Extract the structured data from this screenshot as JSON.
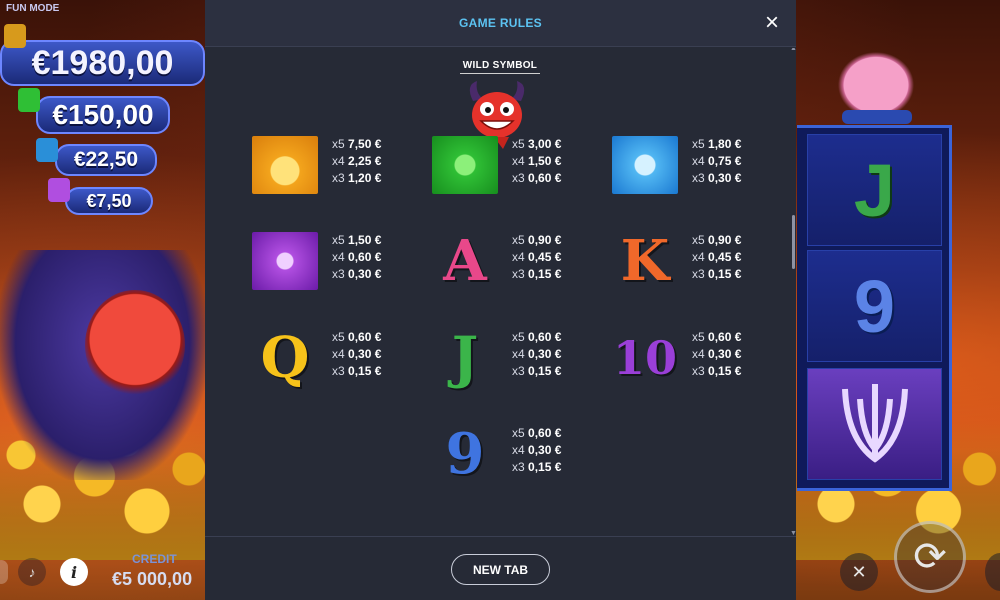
{
  "background": {
    "fun_mode_label": "FUN MODE",
    "jackpots": [
      "€1980,00",
      "€150,00",
      "€22,50",
      "€7,50"
    ],
    "credit_label": "CREDIT",
    "credit_value": "€5 000,00",
    "reel_symbols": [
      "J",
      "9",
      "trident"
    ]
  },
  "modal": {
    "title": "GAME RULES",
    "close_icon": "×",
    "wild_title": "WILD SYMBOL",
    "paytable": [
      {
        "symbol": "crown",
        "lines": [
          {
            "mult": "x5",
            "amt": "7,50 €"
          },
          {
            "mult": "x4",
            "amt": "2,25 €"
          },
          {
            "mult": "x3",
            "amt": "1,20 €"
          }
        ]
      },
      {
        "symbol": "money",
        "lines": [
          {
            "mult": "x5",
            "amt": "3,00 €"
          },
          {
            "mult": "x4",
            "amt": "1,50 €"
          },
          {
            "mult": "x3",
            "amt": "0,60 €"
          }
        ]
      },
      {
        "symbol": "diamond",
        "lines": [
          {
            "mult": "x5",
            "amt": "1,80 €"
          },
          {
            "mult": "x4",
            "amt": "0,75 €"
          },
          {
            "mult": "x3",
            "amt": "0,30 €"
          }
        ]
      },
      {
        "symbol": "trident",
        "lines": [
          {
            "mult": "x5",
            "amt": "1,50 €"
          },
          {
            "mult": "x4",
            "amt": "0,60 €"
          },
          {
            "mult": "x3",
            "amt": "0,30 €"
          }
        ]
      },
      {
        "symbol": "A",
        "lines": [
          {
            "mult": "x5",
            "amt": "0,90 €"
          },
          {
            "mult": "x4",
            "amt": "0,45 €"
          },
          {
            "mult": "x3",
            "amt": "0,15 €"
          }
        ]
      },
      {
        "symbol": "K",
        "lines": [
          {
            "mult": "x5",
            "amt": "0,90 €"
          },
          {
            "mult": "x4",
            "amt": "0,45 €"
          },
          {
            "mult": "x3",
            "amt": "0,15 €"
          }
        ]
      },
      {
        "symbol": "Q",
        "lines": [
          {
            "mult": "x5",
            "amt": "0,60 €"
          },
          {
            "mult": "x4",
            "amt": "0,30 €"
          },
          {
            "mult": "x3",
            "amt": "0,15 €"
          }
        ]
      },
      {
        "symbol": "J",
        "lines": [
          {
            "mult": "x5",
            "amt": "0,60 €"
          },
          {
            "mult": "x4",
            "amt": "0,30 €"
          },
          {
            "mult": "x3",
            "amt": "0,15 €"
          }
        ]
      },
      {
        "symbol": "10",
        "lines": [
          {
            "mult": "x5",
            "amt": "0,60 €"
          },
          {
            "mult": "x4",
            "amt": "0,30 €"
          },
          {
            "mult": "x3",
            "amt": "0,15 €"
          }
        ]
      },
      {
        "symbol": "9",
        "lines": [
          {
            "mult": "x5",
            "amt": "0,60 €"
          },
          {
            "mult": "x4",
            "amt": "0,30 €"
          },
          {
            "mult": "x3",
            "amt": "0,15 €"
          }
        ]
      }
    ],
    "new_tab_label": "NEW TAB"
  },
  "colors": {
    "modal_bg": "#262a36",
    "title_accent": "#5cc3f2",
    "letter_A": "#e8488a",
    "letter_K": "#f0682a",
    "letter_Q": "#f6c21a",
    "letter_J": "#3bb54a",
    "letter_10": "#9a3fd8",
    "letter_9": "#3f74e0"
  },
  "icons": {
    "close": "close-icon",
    "sound": "sound-off-icon",
    "info": "info-icon",
    "turbo": "turbo-off-icon",
    "spin": "spin-icon",
    "wild": "devil-wild-icon"
  }
}
